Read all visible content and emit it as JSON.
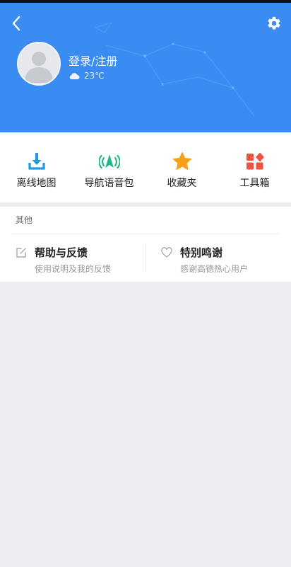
{
  "header": {
    "login_label": "登录/注册",
    "temperature": "23℃",
    "back_icon": "chevron-left-icon",
    "settings_icon": "gear-icon",
    "avatar_icon": "default-user-avatar"
  },
  "quick_actions": [
    {
      "label": "离线地图",
      "icon": "offline-map-download-icon",
      "color": "#1e9de6"
    },
    {
      "label": "导航语音包",
      "icon": "voice-pack-icon",
      "color": "#20b88a"
    },
    {
      "label": "收藏夹",
      "icon": "star-icon",
      "color": "#f6a01a"
    },
    {
      "label": "工具箱",
      "icon": "toolbox-icon",
      "color": "#ee5340"
    }
  ],
  "other": {
    "title": "其他",
    "help": {
      "title": "帮助与反馈",
      "subtitle": "使用说明及我的反馈",
      "icon": "edit-icon"
    },
    "thanks": {
      "title": "特别鸣谢",
      "subtitle": "感谢高德热心用户",
      "icon": "heart-icon"
    }
  },
  "colors": {
    "header_blue": "#3a8cf2",
    "page_background": "#eceef1"
  }
}
